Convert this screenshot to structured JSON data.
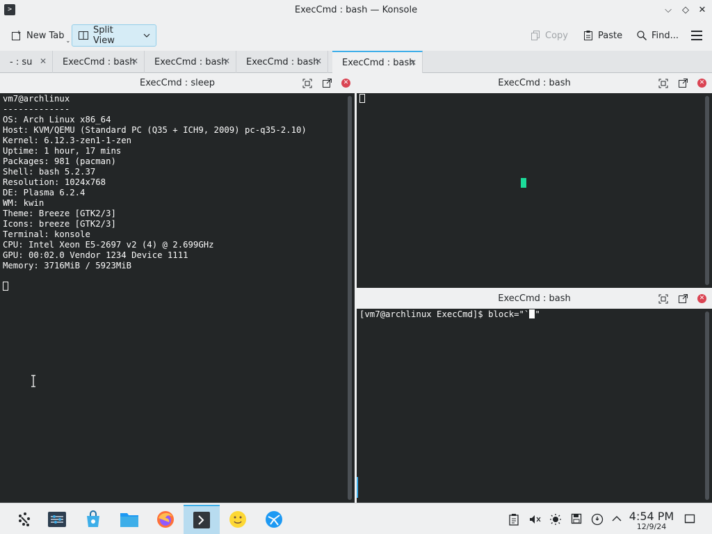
{
  "window": {
    "title": "ExecCmd : bash — Konsole",
    "app_icon_glyph": ">",
    "controls": {
      "minimize": "⌵",
      "maximize": "◇",
      "close": "✕"
    }
  },
  "toolbar": {
    "new_tab_label": "New Tab",
    "split_view_label": "Split View",
    "copy_label": "Copy",
    "paste_label": "Paste",
    "find_label": "Find..."
  },
  "tabs": [
    {
      "label": "- : su",
      "active": false
    },
    {
      "label": "ExecCmd : bash",
      "active": false
    },
    {
      "label": "ExecCmd : bash",
      "active": false
    },
    {
      "label": "ExecCmd : bash",
      "active": false
    },
    {
      "label": "ExecCmd : bash",
      "active": true
    }
  ],
  "panes": {
    "left": {
      "title": "ExecCmd : sleep",
      "lines": [
        "vm7@archlinux",
        "-------------",
        "OS: Arch Linux x86_64",
        "Host: KVM/QEMU (Standard PC (Q35 + ICH9, 2009) pc-q35-2.10)",
        "Kernel: 6.12.3-zen1-1-zen",
        "Uptime: 1 hour, 17 mins",
        "Packages: 981 (pacman)",
        "Shell: bash 5.2.37",
        "Resolution: 1024x768",
        "DE: Plasma 6.2.4",
        "WM: kwin",
        "Theme: Breeze [GTK2/3]",
        "Icons: breeze [GTK2/3]",
        "Terminal: konsole",
        "CPU: Intel Xeon E5-2697 v2 (4) @ 2.699GHz",
        "GPU: 00:02.0 Vendor 1234 Device 1111",
        "Memory: 3716MiB / 5923MiB"
      ]
    },
    "top_right": {
      "title": "ExecCmd : bash"
    },
    "bottom_right": {
      "title": "ExecCmd : bash",
      "prompt": "[vm7@archlinux ExecCmd]$ block=\"`",
      "after_cursor": "\""
    }
  },
  "taskbar": {
    "apps": [
      "application-launcher-icon",
      "system-settings-icon",
      "discover-store-icon",
      "file-manager-icon",
      "firefox-icon",
      "konsole-icon",
      "emoji-icon",
      "browser-icon"
    ],
    "clock_time": "4:54 PM",
    "clock_date": "12/9/24"
  },
  "colors": {
    "terminal_bg": "#232627",
    "terminal_fg": "#fcfcfc",
    "accent": "#3daee9",
    "close_red": "#da4453",
    "green_marker": "#1cdc9a"
  }
}
